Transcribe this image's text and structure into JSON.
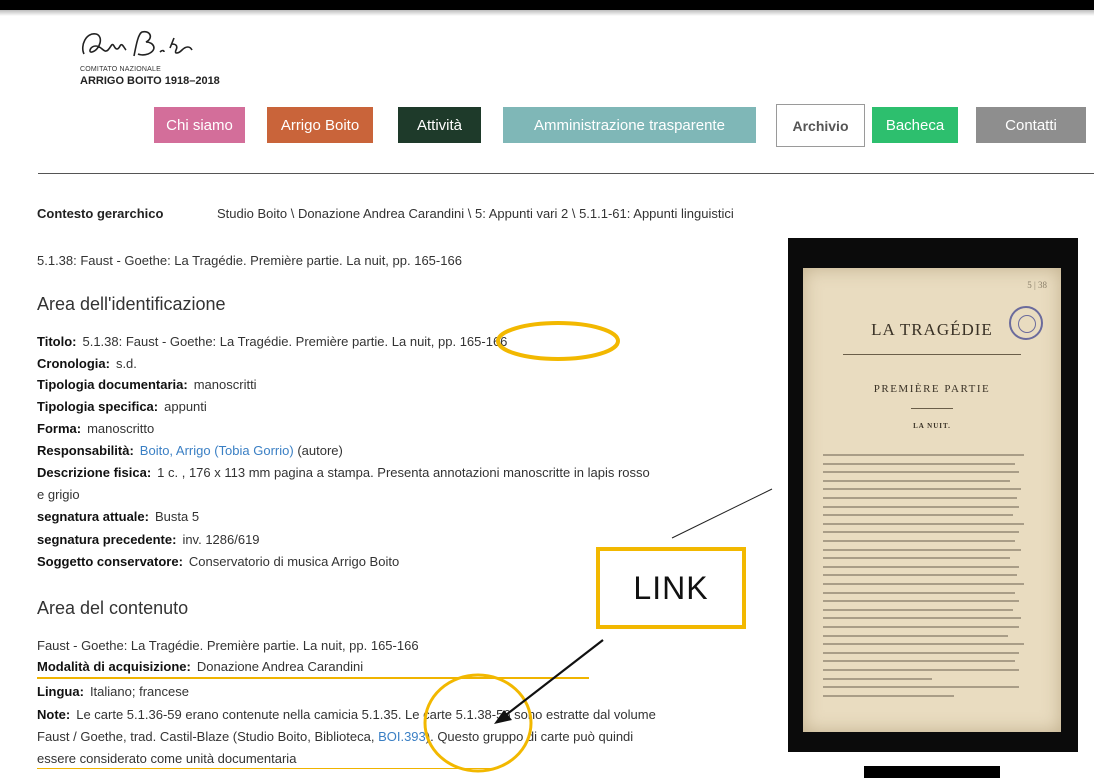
{
  "header": {
    "logo_line1": "COMITATO NAZIONALE",
    "logo_line2": "ARRIGO BOITO 1918–2018"
  },
  "nav": [
    {
      "label": "Chi siamo",
      "color": "#d36e9a"
    },
    {
      "label": "Arrigo Boito",
      "color": "#c9643a"
    },
    {
      "label": "Attività",
      "color": "#1e3a2a"
    },
    {
      "label": "Amministrazione trasparente",
      "color": "#7fb7b7"
    },
    {
      "label": "Archivio",
      "color": "#ffffff"
    },
    {
      "label": "Bacheca",
      "color": "#2dbf6e"
    },
    {
      "label": "Contatti",
      "color": "#8e8e8e"
    }
  ],
  "context": {
    "label": "Contesto gerarchico",
    "value": "Studio Boito \\ Donazione Andrea Carandini \\ 5: Appunti vari 2 \\ 5.1.1-61: Appunti linguistici"
  },
  "record_title": "5.1.38: Faust - Goethe: La Tragédie. Première partie. La nuit, pp. 165-166",
  "identification": {
    "heading": "Area dell'identificazione",
    "fields": [
      {
        "label": "Titolo:",
        "value": "5.1.38: Faust - Goethe: La Tragédie. Première partie. La nuit, pp. 165-166"
      },
      {
        "label": "Cronologia:",
        "value": "s.d."
      },
      {
        "label": "Tipologia documentaria:",
        "value": "manoscritti"
      },
      {
        "label": "Tipologia specifica:",
        "value": "appunti"
      },
      {
        "label": "Forma:",
        "value": "manoscritto"
      },
      {
        "label": "Responsabilità:",
        "link": "Boito, Arrigo (Tobia Gorrio)",
        "value": "(autore)"
      },
      {
        "label": "Descrizione fisica:",
        "value": "1 c. , 176 x 113 mm pagina a stampa. Presenta annotazioni manoscritte in lapis rosso",
        "value2": "e grigio"
      },
      {
        "label": "segnatura attuale:",
        "value": "Busta 5"
      },
      {
        "label": "segnatura precedente:",
        "value": "inv. 1286/619"
      },
      {
        "label": "Soggetto conservatore:",
        "value": "Conservatorio di musica Arrigo Boito"
      }
    ]
  },
  "content": {
    "heading": "Area del contenuto",
    "description": "Faust - Goethe: La Tragédie. Première partie. La nuit, pp. 165-166",
    "acquisition_label": "Modalità di acquisizione:",
    "acquisition_value": "Donazione Andrea Carandini",
    "language_label": "Lingua:",
    "language_value": "Italiano; francese",
    "note_label": "Note:",
    "note_line1": "Le carte 5.1.36-59 erano contenute nella camicia 5.1.35. Le carte 5.1.38-56 sono estratte dal volume",
    "note_line2_a": "Faust / Goethe, trad. Castil-Blaze (Studio Boito, Biblioteca, ",
    "note_link": "BOI.393",
    "note_line2_b": "). Questo gruppo di carte può quindi",
    "note_line3": "essere considerato come unità documentaria"
  },
  "scan": {
    "page_number": "5 | 38",
    "title": "LA TRAGÉDIE",
    "subtitle": "PREMIÈRE PARTIE",
    "scene": "LA NUIT."
  },
  "annotation": {
    "label": "LINK",
    "color": "#f2b800"
  }
}
